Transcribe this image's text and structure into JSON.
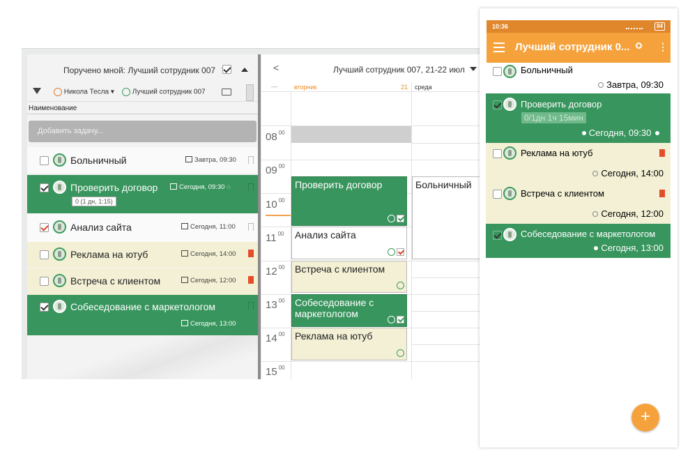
{
  "desktop": {
    "panel_header": "Поручено мной: Лучший сотрудник 007",
    "toolbar": {
      "user1": "Никола Тесла",
      "user2": "Лучший сотрудник 007"
    },
    "column_header": "Наименование",
    "add_task_placeholder": "Добавить задачу...",
    "tasks": [
      {
        "title": "Больничный",
        "due": "Завтра, 09:30",
        "style": "white",
        "checked": false
      },
      {
        "title": "Проверить договор",
        "due": "Сегодня, 09:30",
        "style": "green",
        "checked": true,
        "badge": "0 (1 дн, 1:15)"
      },
      {
        "title": "Анализ сайта",
        "due": "Сегодня, 11:00",
        "style": "white",
        "checked": true
      },
      {
        "title": "Реклама на ютуб",
        "due": "Сегодня, 14:00",
        "style": "beige",
        "checked": false
      },
      {
        "title": "Встреча с клиентом",
        "due": "Сегодня, 12:00",
        "style": "beige",
        "checked": false
      },
      {
        "title": "Собеседование с маркетологом",
        "due": "Сегодня, 13:00",
        "style": "green",
        "checked": true
      }
    ],
    "calendar": {
      "back": "<",
      "title": "Лучший сотрудник 007, 21-22 июл",
      "dash": "—",
      "day1": "вторник",
      "day1_num": "21",
      "day2": "среда",
      "hours": [
        "08",
        "09",
        "10",
        "11",
        "12",
        "13",
        "14",
        "15"
      ],
      "minutes": "00",
      "events": {
        "e1": "Проверить договор",
        "e2": "Анализ сайта",
        "e3": "Встреча с клиентом",
        "e4": "Собеседование с маркетологом",
        "e5": "Реклама на ютуб",
        "e6": "Больничный"
      }
    }
  },
  "phone": {
    "time": "10:36",
    "battery": "84",
    "title": "Лучший сотрудник 0...",
    "tasks": [
      {
        "title": "Больничный",
        "due": "Завтра, 09:30"
      },
      {
        "title": "Проверить договор",
        "due": "Сегодня, 09:30",
        "badge": "0/1дн 1ч 15мин"
      },
      {
        "title": "Реклама на ютуб",
        "due": "Сегодня, 14:00"
      },
      {
        "title": "Встреча с клиентом",
        "due": "Сегодня, 12:00"
      },
      {
        "title": "Собеседование с маркетологом",
        "due": "Сегодня, 13:00"
      }
    ],
    "fab": "+"
  },
  "colors": {
    "green": "#38955d",
    "beige": "#f3f0d5",
    "orange": "#f6a23c",
    "red_flag": "#e44d2a"
  }
}
